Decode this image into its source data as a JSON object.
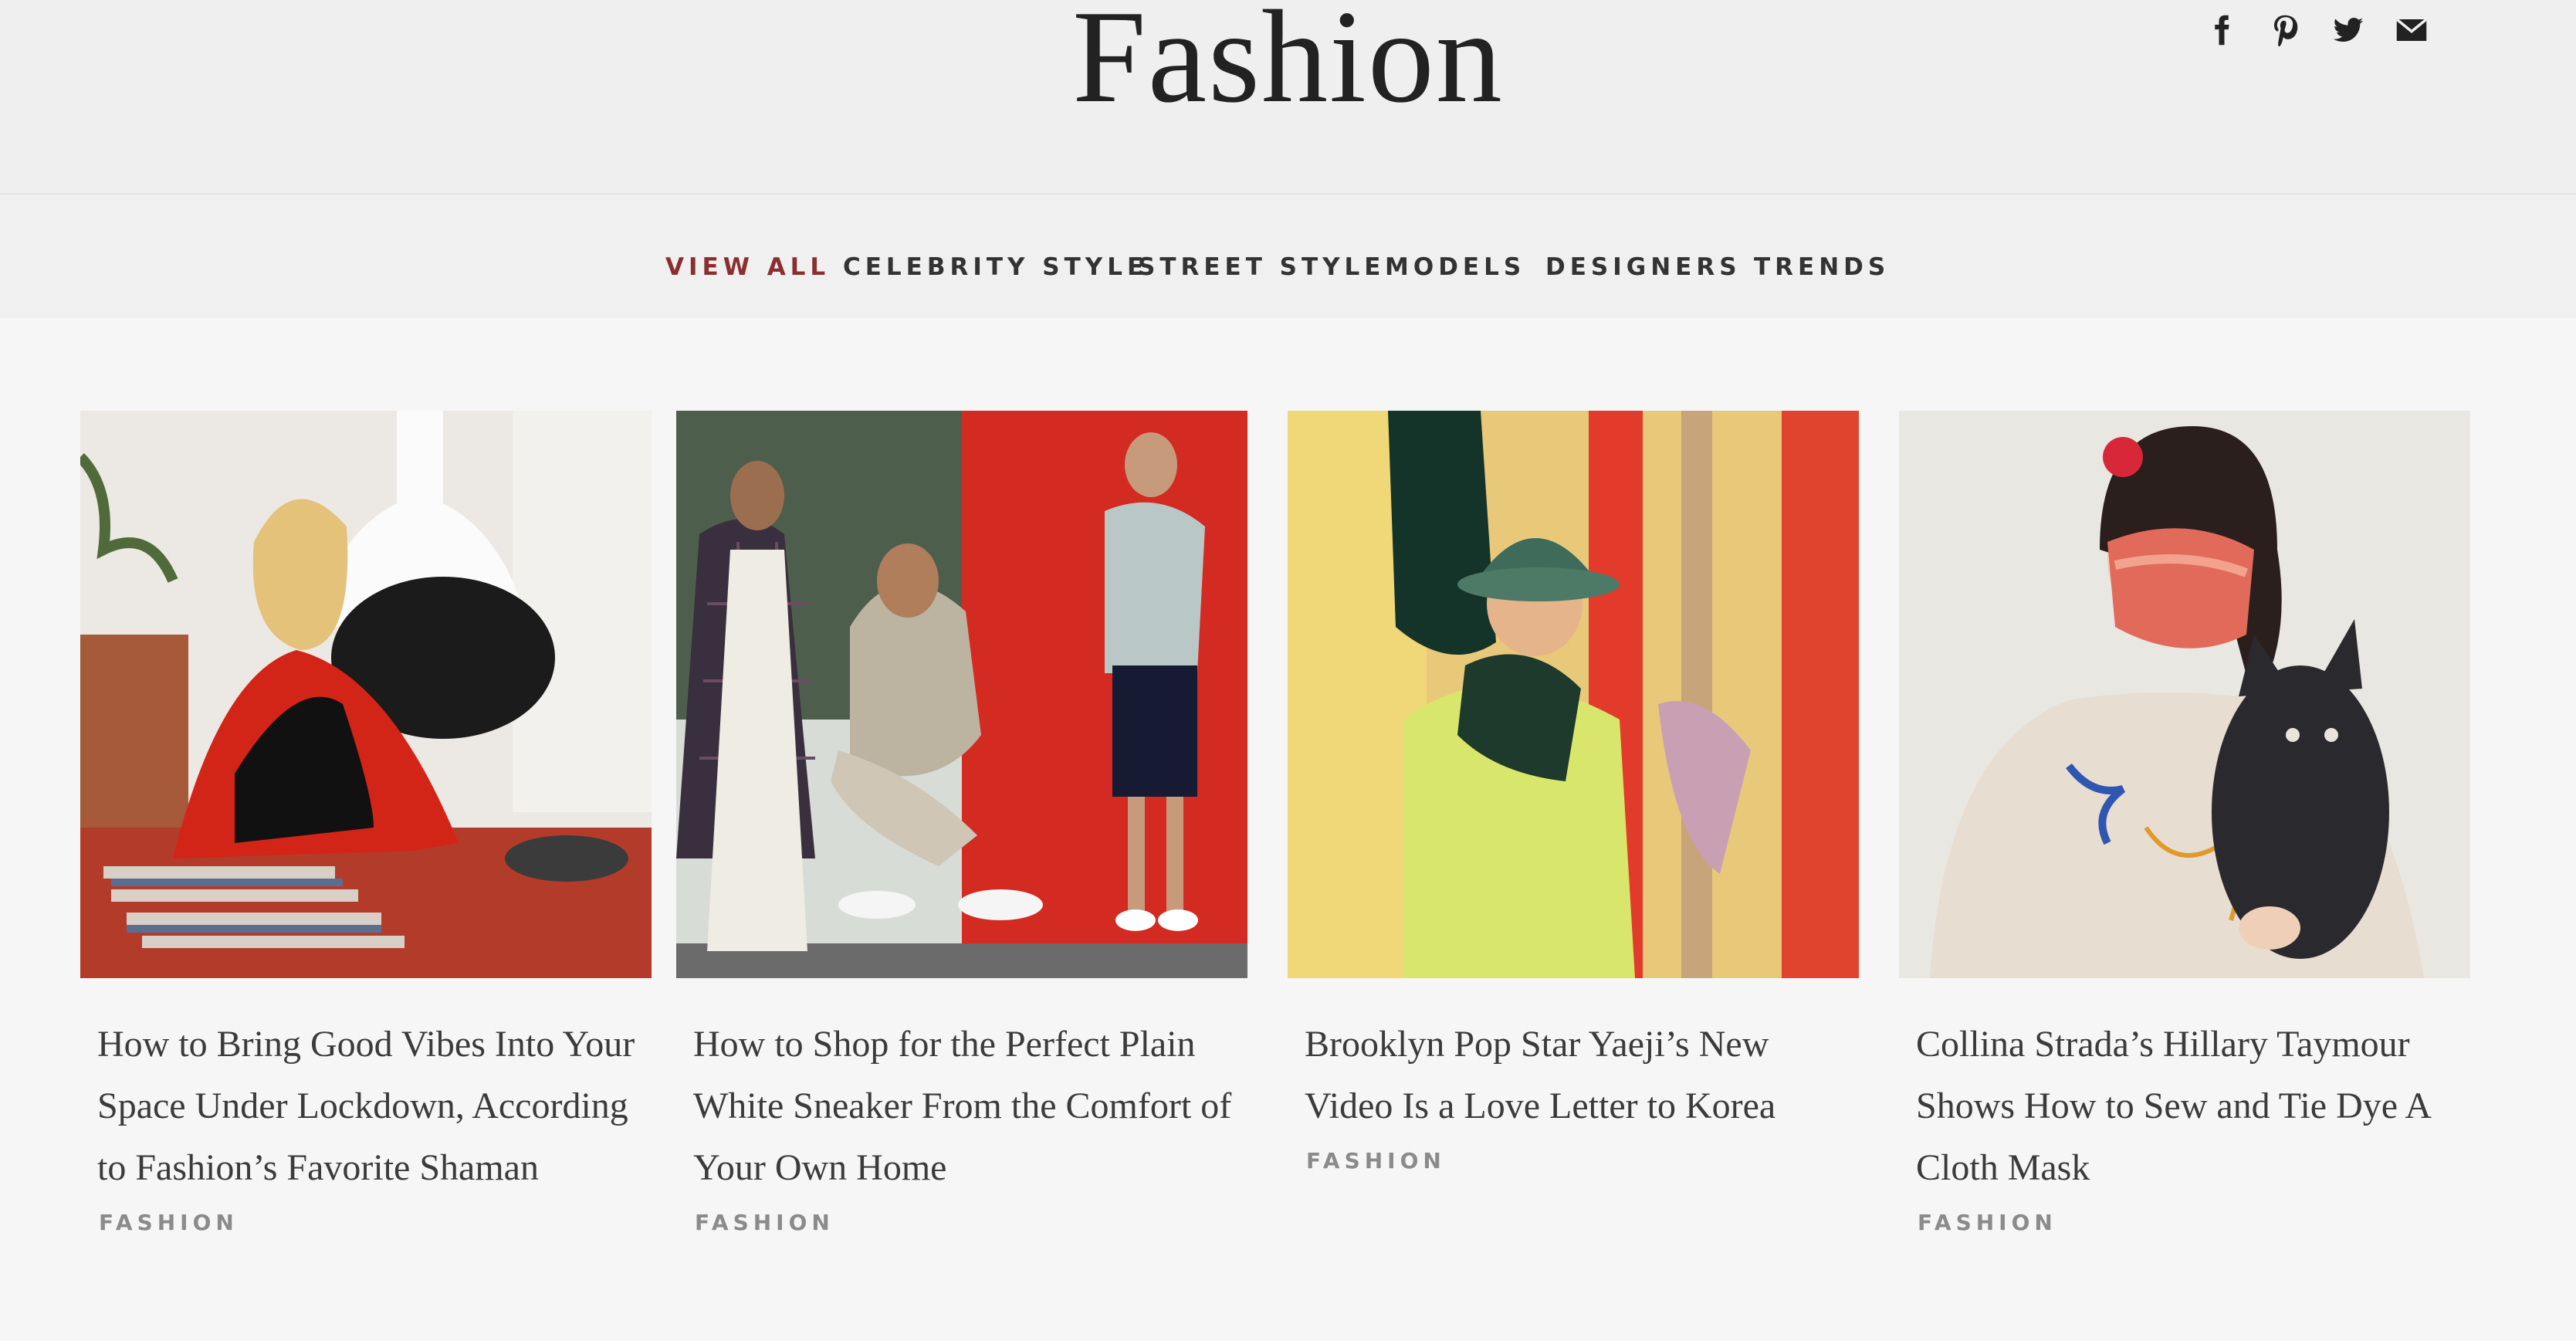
{
  "header": {
    "title": "Fashion",
    "social": [
      {
        "icon": "facebook-icon"
      },
      {
        "icon": "pinterest-icon"
      },
      {
        "icon": "twitter-icon"
      },
      {
        "icon": "email-icon"
      }
    ]
  },
  "nav": {
    "items": [
      {
        "label": "VIEW ALL",
        "active": true
      },
      {
        "label": "CELEBRITY STYLE",
        "active": false
      },
      {
        "label": "STREET STYLE",
        "active": false
      },
      {
        "label": "MODELS",
        "active": false
      },
      {
        "label": "DESIGNERS",
        "active": false
      },
      {
        "label": "TRENDS",
        "active": false
      }
    ]
  },
  "articles": [
    {
      "headline": "How to Bring Good Vibes Into Your Space Under Lockdown, According to Fashion’s Favorite Shaman",
      "tag": "FASHION",
      "image": "woman-with-red-blanket-and-fireplace"
    },
    {
      "headline": "How to Shop for the Perfect Plain White Sneaker From the Comfort of Your Own Home",
      "tag": "FASHION",
      "image": "three-women-white-sneakers-collage"
    },
    {
      "headline": "Brooklyn Pop Star Yaeji’s New Video Is a Love Letter to Korea",
      "tag": "FASHION",
      "image": "yaeji-bucket-hat-colorful-background"
    },
    {
      "headline": "Collina Strada’s Hillary Taymour Shows How to Sew and Tie Dye A Cloth Mask",
      "tag": "FASHION",
      "image": "woman-in-tie-dye-mask-holding-dog"
    }
  ],
  "colors": {
    "accent": "#8a2f2f",
    "tag_gray": "#8b8b8b",
    "background": "#f4f4f4"
  }
}
